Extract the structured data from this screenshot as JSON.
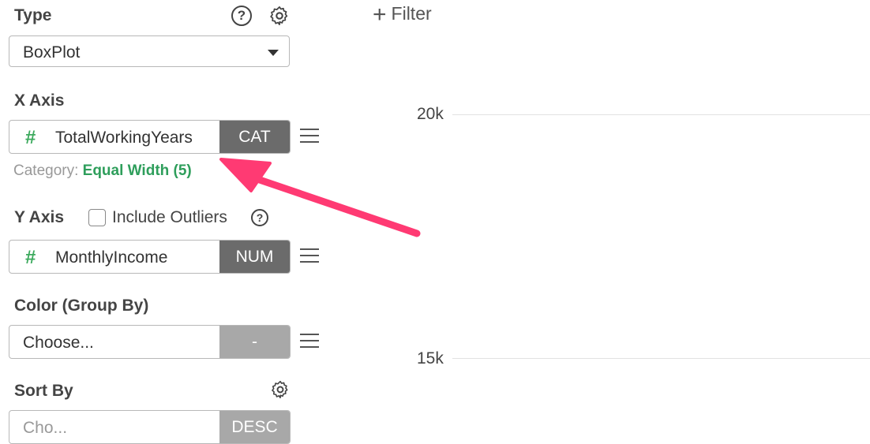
{
  "type_section": {
    "label": "Type",
    "selected": "BoxPlot"
  },
  "x_axis": {
    "label": "X Axis",
    "field": "TotalWorkingYears",
    "chip": "CAT",
    "category_prefix": "Category:",
    "category_value": "Equal Width (5)"
  },
  "y_axis": {
    "label": "Y Axis",
    "outliers_label": "Include Outliers",
    "outliers_checked": false,
    "field": "MonthlyIncome",
    "chip": "NUM"
  },
  "color_section": {
    "label": "Color (Group By)",
    "placeholder": "Choose...",
    "chip": "-"
  },
  "sort_section": {
    "label": "Sort By",
    "placeholder": "Cho...",
    "chip": "DESC"
  },
  "filter": {
    "label": "Filter"
  },
  "chart": {
    "ticks": [
      "20k",
      "15k"
    ]
  },
  "colors": {
    "accent_green": "#3daa5e",
    "chip_dark": "#6b6b6b",
    "chip_light": "#a8a8a8",
    "arrow": "#ff3a73"
  },
  "icons": [
    "help-icon",
    "gear-icon",
    "chevron-down-icon",
    "hamburger-menu-icon",
    "plus-icon",
    "annotation-arrow"
  ]
}
